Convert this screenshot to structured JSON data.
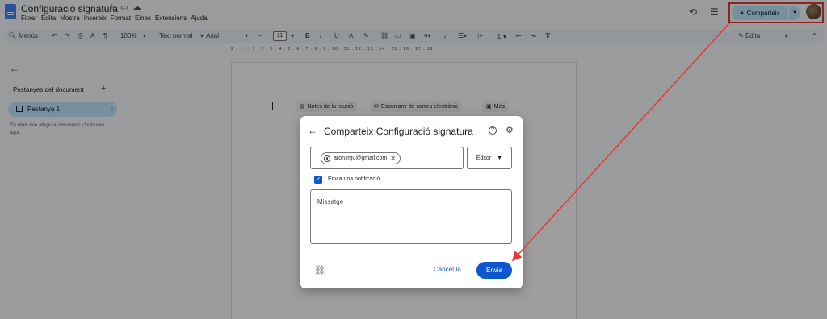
{
  "doc": {
    "title": "Configuració signatura",
    "menu": [
      "Fitxer",
      "Edita",
      "Mostra",
      "Insereix",
      "Format",
      "Eines",
      "Extensions",
      "Ajuda"
    ]
  },
  "header": {
    "share_label": "Comparteix"
  },
  "toolbar": {
    "menus": "Menús",
    "zoom": "100%",
    "style": "Text normal",
    "font": "Arial",
    "font_size": "11",
    "edit_mode": "Edita"
  },
  "ruler": {
    "marks": "2 . 1 . . 1 . 2 . 3 . 4 . 5 . 6 . 7 . 8 . 9 . 10 . 11 . 12 . 13 . 14 . 15 . 16 . 17 . 18"
  },
  "sidebar": {
    "heading": "Pestanyes del document",
    "tab_label": "Pestanya 1",
    "hint": "Els títols que afegiu al document s'inclouran aquí."
  },
  "page": {
    "chips": [
      {
        "label": "Notes de la reunió"
      },
      {
        "label": "Esborrany de correu electrònic"
      },
      {
        "label": "Més"
      }
    ]
  },
  "dialog": {
    "title": "Comparteix Configuració signatura",
    "person_email": "aron.mju@gmail.com",
    "role": "Editor",
    "notify_label": "Envia una notificació",
    "message_placeholder": "Missatge",
    "cancel_label": "Cancel·la",
    "send_label": "Envia"
  },
  "colors": {
    "accent": "#0b57d0",
    "share_bg": "#c2e7ff",
    "annotation": "#e53935"
  }
}
